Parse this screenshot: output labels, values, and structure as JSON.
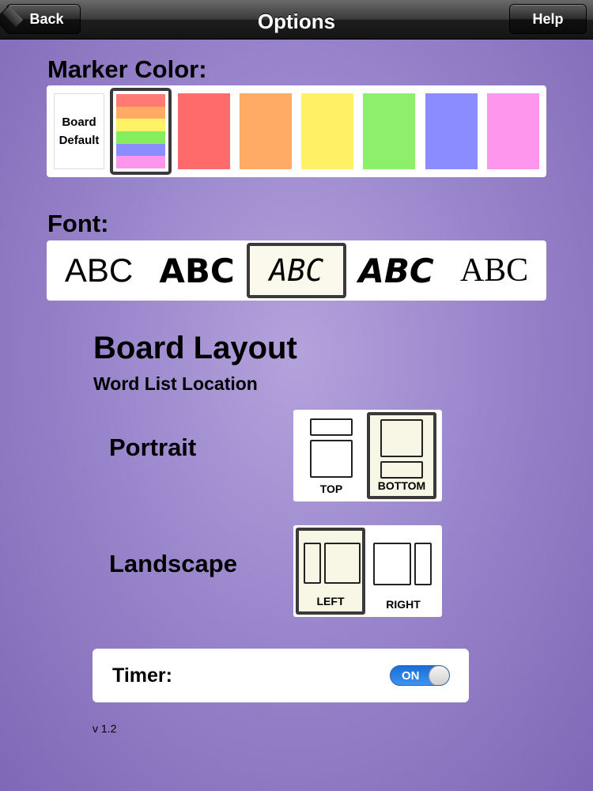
{
  "navbar": {
    "title": "Options",
    "back_label": "Back",
    "help_label": "Help"
  },
  "marker_color": {
    "label": "Marker Color:",
    "board_default_line1": "Board",
    "board_default_line2": "Default",
    "rainbow": [
      "#ff7a73",
      "#ffab66",
      "#fff266",
      "#85ee5c",
      "#8a8cff",
      "#ff96ee"
    ],
    "swatches": [
      "#ff6b6b",
      "#ffab66",
      "#fff066",
      "#8ef06a",
      "#8a8cff",
      "#ff96ee"
    ],
    "selected": "rainbow"
  },
  "font": {
    "label": "Font:",
    "samples": [
      "ABC",
      "ABC",
      "ABC",
      "ABC",
      "ABC"
    ],
    "selected_index": 2
  },
  "board_layout": {
    "title": "Board Layout",
    "subtitle": "Word List Location",
    "portrait": {
      "label": "Portrait",
      "options": [
        "TOP",
        "BOTTOM"
      ],
      "selected": "BOTTOM"
    },
    "landscape": {
      "label": "Landscape",
      "options": [
        "LEFT",
        "RIGHT"
      ],
      "selected": "LEFT"
    }
  },
  "timer": {
    "label": "Timer:",
    "state": "ON"
  },
  "version": "v 1.2"
}
